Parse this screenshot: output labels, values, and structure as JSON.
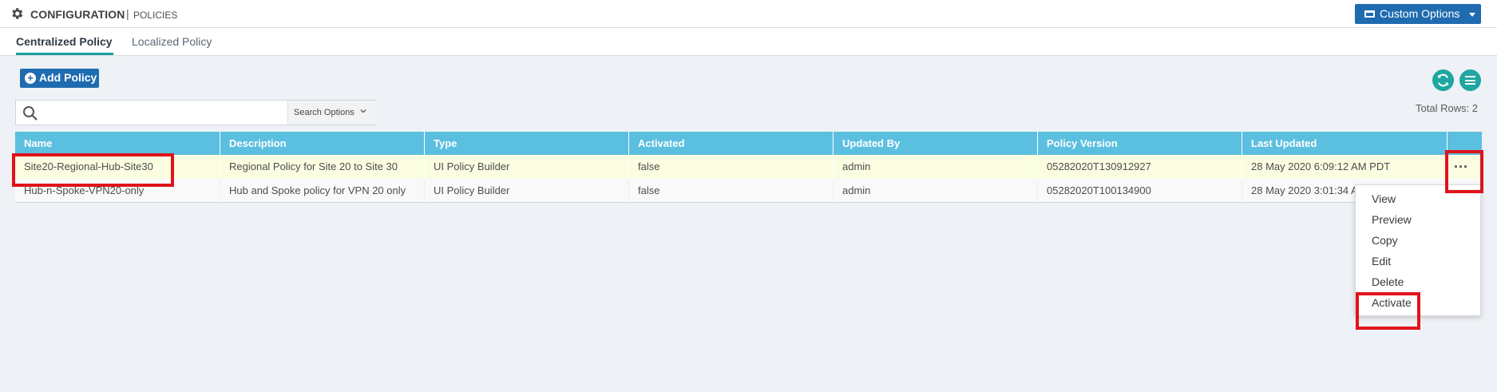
{
  "header": {
    "title": "CONFIGURATION",
    "separator": "|",
    "subtitle": "POLICIES",
    "custom_options_label": "Custom Options"
  },
  "tabs": [
    {
      "label": "Centralized Policy",
      "active": true
    },
    {
      "label": "Localized Policy",
      "active": false
    }
  ],
  "toolbar": {
    "add_policy_label": "Add Policy",
    "search_placeholder": "",
    "search_options_label": "Search Options",
    "total_rows_label": "Total Rows: 2"
  },
  "table": {
    "columns": [
      "Name",
      "Description",
      "Type",
      "Activated",
      "Updated By",
      "Policy Version",
      "Last Updated"
    ],
    "rows": [
      {
        "name": "Site20-Regional-Hub-Site30",
        "description": "Regional Policy for Site 20 to Site 30",
        "type": "UI Policy Builder",
        "activated": "false",
        "updated_by": "admin",
        "policy_version": "05282020T130912927",
        "last_updated": "28 May 2020 6:09:12 AM PDT"
      },
      {
        "name": "Hub-n-Spoke-VPN20-only",
        "description": "Hub and Spoke policy for VPN 20 only",
        "type": "UI Policy Builder",
        "activated": "false",
        "updated_by": "admin",
        "policy_version": "05282020T100134900",
        "last_updated": "28 May 2020 3:01:34 AM PDT"
      }
    ],
    "more_actions_label": "..."
  },
  "context_menu": {
    "items": [
      "View",
      "Preview",
      "Copy",
      "Edit",
      "Delete",
      "Activate"
    ]
  },
  "icons": {
    "settings": "gear-icon",
    "custom_options": "window-icon",
    "add": "plus-icon",
    "refresh": "refresh-icon",
    "menu": "hamburger-icon",
    "search": "search-icon",
    "dropdown": "chevron-down-icon"
  },
  "colors": {
    "primary_button": "#1f6bb0",
    "table_header": "#5bbfdf",
    "active_tab_underline": "#1e9e9e",
    "round_button": "#1ea6a0",
    "highlight_row": "#fbfde1",
    "annotation_red": "#e0131b"
  }
}
